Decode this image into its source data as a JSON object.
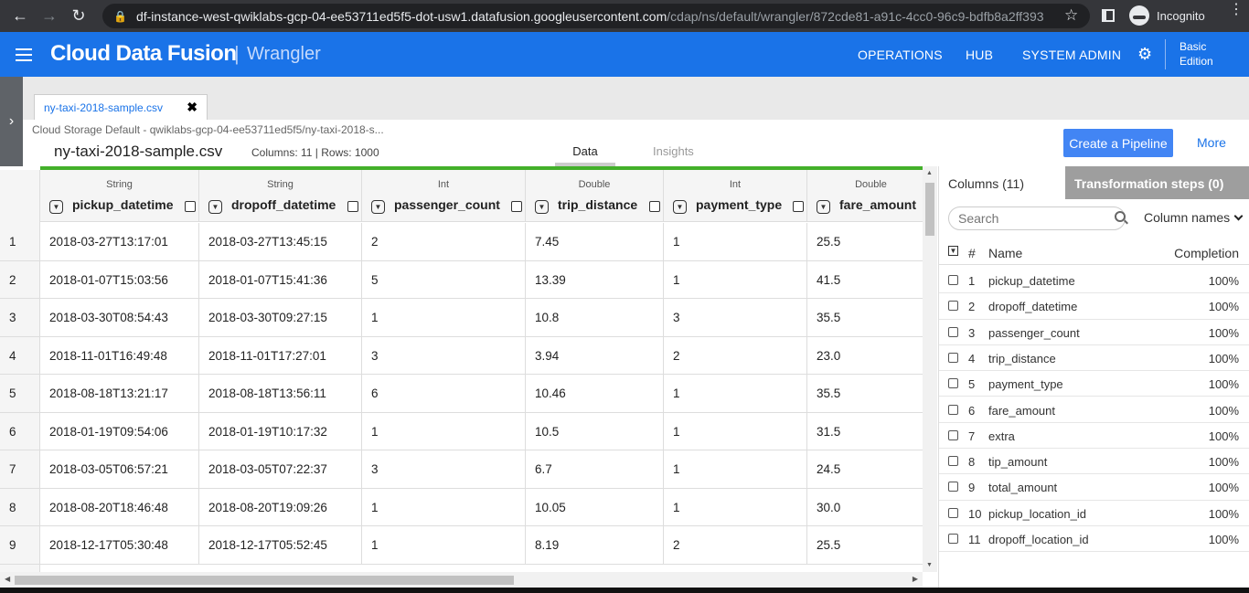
{
  "browser": {
    "url_host": "df-instance-west-qwiklabs-gcp-04-ee53711ed5f5-dot-usw1.datafusion.googleusercontent.com",
    "url_path": "/cdap/ns/default/wrangler/872cde81-a91c-4cc0-96c9-bdfb8a2ff393",
    "profile_label": "Incognito"
  },
  "header": {
    "brand": "Cloud Data Fusion",
    "separator": "|",
    "subtitle": "Wrangler",
    "nav": [
      "OPERATIONS",
      "HUB",
      "SYSTEM ADMIN"
    ],
    "edition_line1": "Basic",
    "edition_line2": "Edition"
  },
  "workspace": {
    "tab_label": "ny-taxi-2018-sample.csv",
    "source_path": "Cloud Storage Default - qwiklabs-gcp-04-ee53711ed5f5/ny-taxi-2018-s...",
    "dataset_name": "ny-taxi-2018-sample.csv",
    "dataset_info": "Columns: 11 | Rows: 1000",
    "view_tabs": [
      "Data",
      "Insights"
    ],
    "create_pipeline_label": "Create a Pipeline",
    "more_label": "More"
  },
  "grid": {
    "columns": [
      {
        "type": "String",
        "name": "pickup_datetime"
      },
      {
        "type": "String",
        "name": "dropoff_datetime"
      },
      {
        "type": "Int",
        "name": "passenger_count"
      },
      {
        "type": "Double",
        "name": "trip_distance"
      },
      {
        "type": "Int",
        "name": "payment_type"
      },
      {
        "type": "Double",
        "name": "fare_amount"
      }
    ],
    "rows": [
      [
        "1",
        "2018-03-27T13:17:01",
        "2018-03-27T13:45:15",
        "2",
        "7.45",
        "1",
        "25.5"
      ],
      [
        "2",
        "2018-01-07T15:03:56",
        "2018-01-07T15:41:36",
        "5",
        "13.39",
        "1",
        "41.5"
      ],
      [
        "3",
        "2018-03-30T08:54:43",
        "2018-03-30T09:27:15",
        "1",
        "10.8",
        "3",
        "35.5"
      ],
      [
        "4",
        "2018-11-01T16:49:48",
        "2018-11-01T17:27:01",
        "3",
        "3.94",
        "2",
        "23.0"
      ],
      [
        "5",
        "2018-08-18T13:21:17",
        "2018-08-18T13:56:11",
        "6",
        "10.46",
        "1",
        "35.5"
      ],
      [
        "6",
        "2018-01-19T09:54:06",
        "2018-01-19T10:17:32",
        "1",
        "10.5",
        "1",
        "31.5"
      ],
      [
        "7",
        "2018-03-05T06:57:21",
        "2018-03-05T07:22:37",
        "3",
        "6.7",
        "1",
        "24.5"
      ],
      [
        "8",
        "2018-08-20T18:46:48",
        "2018-08-20T19:09:26",
        "1",
        "10.05",
        "1",
        "30.0"
      ],
      [
        "9",
        "2018-12-17T05:30:48",
        "2018-12-17T05:52:45",
        "1",
        "8.19",
        "2",
        "25.5"
      ]
    ]
  },
  "panel": {
    "tab_columns": "Columns (11)",
    "tab_steps": "Transformation steps (0)",
    "search_placeholder": "Search",
    "sort_label": "Column names",
    "header_num": "#",
    "header_name": "Name",
    "header_completion": "Completion",
    "columns": [
      {
        "num": "1",
        "name": "pickup_datetime",
        "completion": "100%"
      },
      {
        "num": "2",
        "name": "dropoff_datetime",
        "completion": "100%"
      },
      {
        "num": "3",
        "name": "passenger_count",
        "completion": "100%"
      },
      {
        "num": "4",
        "name": "trip_distance",
        "completion": "100%"
      },
      {
        "num": "5",
        "name": "payment_type",
        "completion": "100%"
      },
      {
        "num": "6",
        "name": "fare_amount",
        "completion": "100%"
      },
      {
        "num": "7",
        "name": "extra",
        "completion": "100%"
      },
      {
        "num": "8",
        "name": "tip_amount",
        "completion": "100%"
      },
      {
        "num": "9",
        "name": "total_amount",
        "completion": "100%"
      },
      {
        "num": "10",
        "name": "pickup_location_id",
        "completion": "100%"
      },
      {
        "num": "11",
        "name": "dropoff_location_id",
        "completion": "100%"
      }
    ]
  },
  "colors": {
    "header_blue": "#1a73e8",
    "button_blue": "#4285f4",
    "grid_green": "#43b02a"
  }
}
